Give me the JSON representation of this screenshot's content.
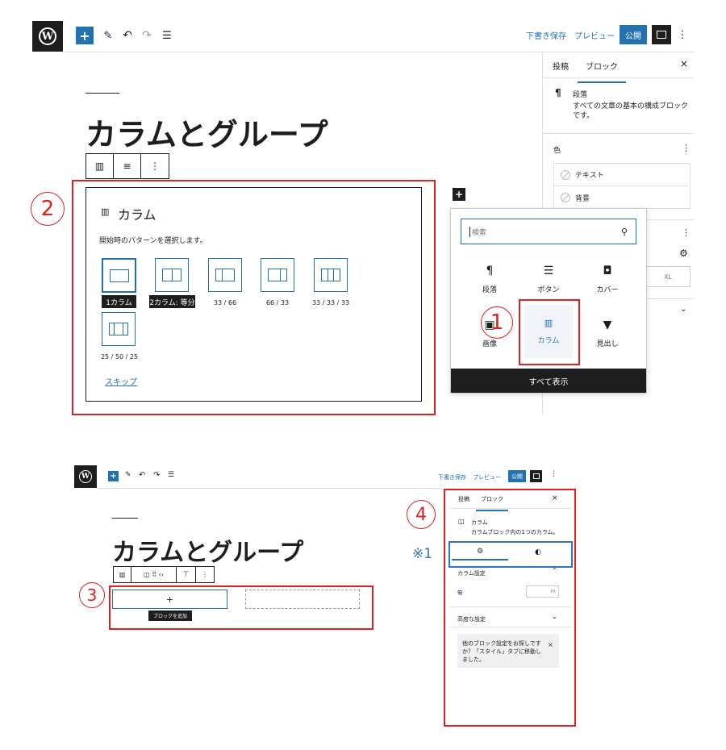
{
  "top": {
    "logo": "W",
    "icons": [
      "plus-icon",
      "pencil-icon",
      "undo-icon",
      "redo-icon",
      "list-view-icon",
      "settings-panel-icon",
      "more-icon"
    ],
    "save_draft": "下書き保存",
    "preview": "プレビュー",
    "publish": "公開",
    "post_title": "カラムとグループ"
  },
  "sidebar_top": {
    "tab_post": "投稿",
    "tab_block": "ブロック",
    "close": "×",
    "block_name": "段落",
    "block_desc": "すべての文章の基本の構成ブロックです。",
    "color_heading": "色",
    "color_text": "テキスト",
    "color_bg": "背景",
    "size_xl": "XL"
  },
  "columns_placeholder": {
    "label": "カラム",
    "instruction": "開始時のパターンを選択します。",
    "patterns": [
      "1カラム",
      "2カラム: 等分",
      "33 / 66",
      "66 / 33",
      "33 / 33 / 33",
      "25 / 50 / 25"
    ],
    "skip": "スキップ"
  },
  "inserter": {
    "search_placeholder": "検索",
    "items": [
      "段落",
      "ボタン",
      "カバー",
      "画像",
      "カラム",
      "見出し"
    ],
    "show_all": "すべて表示"
  },
  "annotations": {
    "a1": "1",
    "a2": "2",
    "a3": "3",
    "a4": "4",
    "note1": "※1"
  },
  "bottom": {
    "save_draft": "下書き保存",
    "preview": "プレビュー",
    "publish": "公開",
    "post_title": "カラムとグループ",
    "add_block_tip": "ブロックを追加",
    "plus": "+",
    "tab_post": "投稿",
    "tab_block": "ブロック",
    "close": "×",
    "block_name": "カラム",
    "block_desc": "カラムブロック内の1つのカラム。",
    "col_settings": "カラム設定",
    "width_label": "幅",
    "width_unit": "PX",
    "advanced": "高度な設定",
    "notice": "他のブロック設定をお探しですか？「スタイル」タブに移動しました。",
    "notice_close": "×"
  },
  "colors": {
    "accent": "#2271b1",
    "annotation": "#e0201e",
    "dark": "#1e1e1e"
  }
}
